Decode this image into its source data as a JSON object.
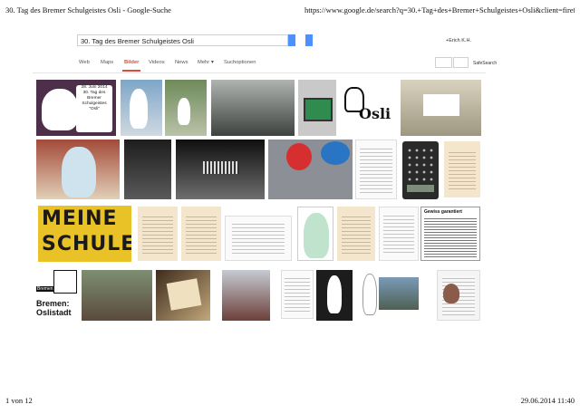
{
  "print_header": {
    "title": "30. Tag des Bremer Schulgeistes Osli - Google-Suche",
    "url": "https://www.google.de/search?q=30.+Tag+des+Bremer+Schulgeistes+Osli&client=firefox-a&hs=..."
  },
  "search": {
    "query": "30. Tag des Bremer Schulgeistes Osli"
  },
  "user": {
    "name": "+Erich K.H."
  },
  "nav": {
    "items": [
      "Web",
      "Maps",
      "Bilder",
      "Videos",
      "News",
      "Mehr ▾",
      "Suchoptionen"
    ],
    "active": "Bilder"
  },
  "safesearch_label": "SafeSearch",
  "tiles": {
    "poster_text": "28. Juni 2014\n30. Tag des\nBremer Schulgeistes\n\"Osli\"",
    "meine_line1": "MEINE",
    "meine_line2": "SCHULE",
    "osli_word": "Osli",
    "bremen_badge": "Bremen",
    "bremen_label": "Bremen:\nOslistadt",
    "gewitter_title": "Gewiss garantiert"
  },
  "print_footer": {
    "page": "1 von 12",
    "datetime": "29.06.2014 11:40"
  },
  "colors": {
    "accent": "#dd4b39",
    "search_button": "#4d90fe"
  }
}
